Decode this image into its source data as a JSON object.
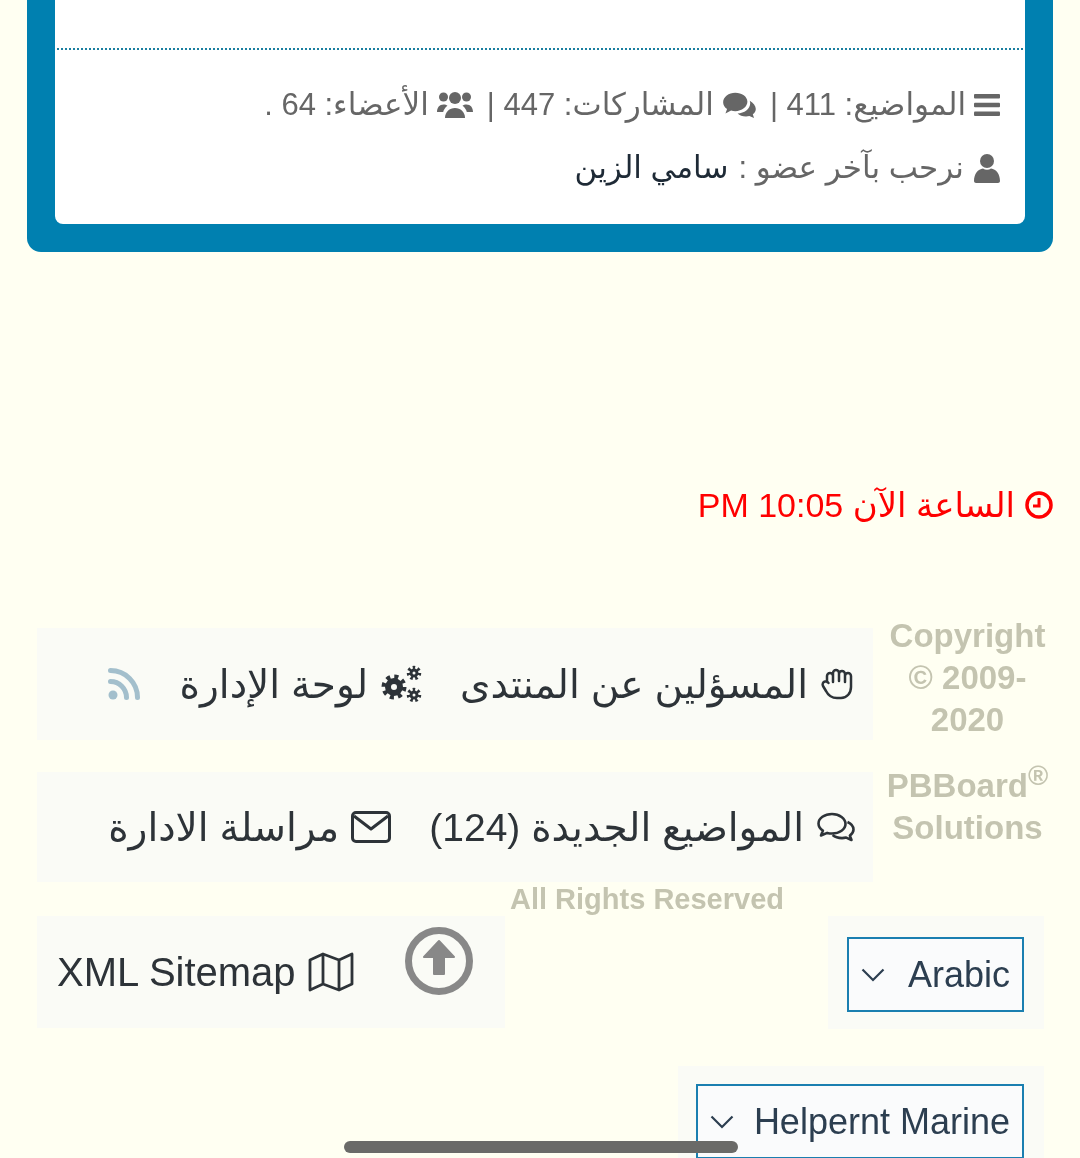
{
  "stats_card": {
    "stats": [
      {
        "kind": "topics",
        "text": "المواضيع: 411 |"
      },
      {
        "kind": "posts",
        "text": "المشاركات: 447 |"
      },
      {
        "kind": "members",
        "text": "الأعضاء: 64 ."
      }
    ],
    "newest_member": {
      "label": "نرحب بآخر عضو :",
      "name": "سامي الزين"
    }
  },
  "clock": {
    "text": "الساعة الآن 10:05 PM"
  },
  "footer": {
    "link_rows": [
      [
        {
          "kind": "hand",
          "text": "المسؤلين عن المنتدى"
        },
        {
          "kind": "gears",
          "text": "لوحة الإدارة"
        },
        {
          "kind": "rss"
        }
      ],
      [
        {
          "kind": "comments",
          "text": "المواضيع الجديدة (124)"
        },
        {
          "kind": "envelope",
          "text": "مراسلة الادارة"
        }
      ]
    ],
    "copyright": {
      "notice": "Copyright © 2009-2020",
      "brand": "PBBoard$^{®}$ Solutions",
      "rights": "All Rights Reserved"
    },
    "sitemap_link": {
      "text": "XML Sitemap"
    },
    "language_select": {
      "value": "Arabic"
    },
    "style_select": {
      "value": "Helpernt Marine"
    }
  }
}
